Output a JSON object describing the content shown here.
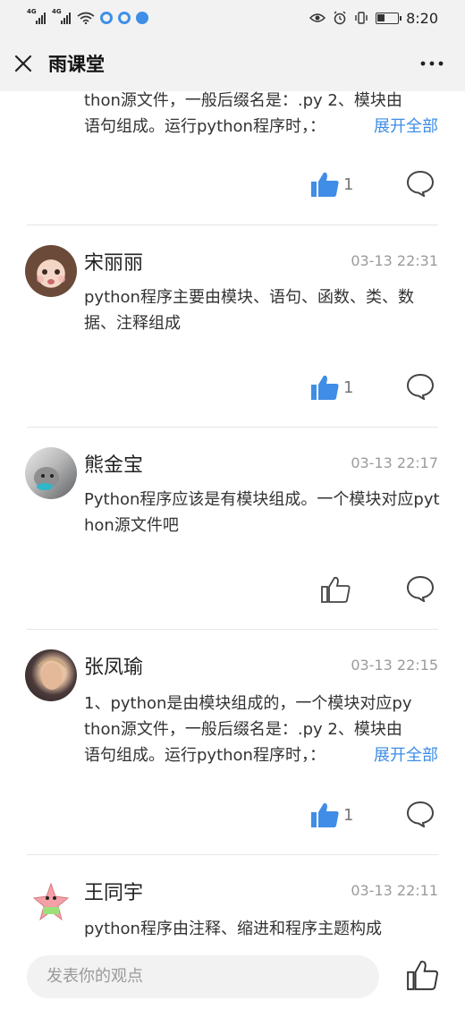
{
  "status_bar": {
    "time": "8:20",
    "network_tag": "4G"
  },
  "header": {
    "title": "雨课堂"
  },
  "comments": [
    {
      "text_line1": "thon源文件，一般后缀名是：.py 2、模块由",
      "text_line2": "语句组成。运行python程序时，：",
      "expand_label": "展开全部",
      "likes": "1"
    },
    {
      "author": "宋丽丽",
      "time": "03-13 22:31",
      "text": "python程序主要由模块、语句、函数、类、数据、注释组成",
      "likes": "1"
    },
    {
      "author": "熊金宝",
      "time": "03-13 22:17",
      "text": "Python程序应该是有模块组成。一个模块对应python源文件吧",
      "likes": ""
    },
    {
      "author": "张凤瑜",
      "time": "03-13 22:15",
      "text_line1": "1、python是由模块组成的，一个模块对应py",
      "text_line2": "thon源文件，一般后缀名是：.py 2、模块由",
      "text_line3": "语句组成。运行python程序时，：",
      "expand_label": "展开全部",
      "likes": "1"
    },
    {
      "author": "王同宇",
      "time": "03-13 22:11",
      "text": "python程序由注释、缩进和程序主题构成"
    }
  ],
  "bottom_bar": {
    "placeholder": "发表你的观点"
  },
  "colors": {
    "accent": "#3f8de6",
    "like_active": "#3f8de6"
  },
  "icons": [
    "close-icon",
    "more-icon",
    "thumbs-up-icon",
    "comment-bubble-icon"
  ]
}
